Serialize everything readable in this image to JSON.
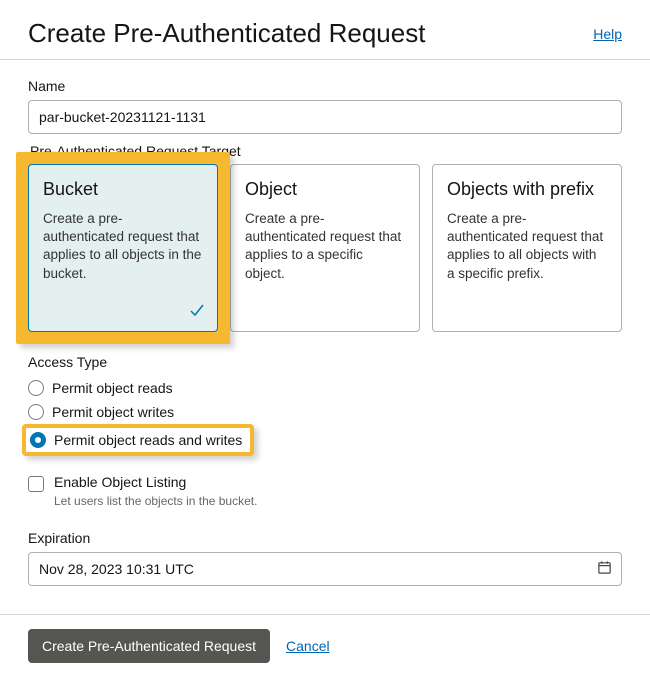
{
  "header": {
    "title": "Create Pre-Authenticated Request",
    "help_label": "Help"
  },
  "form": {
    "name_label": "Name",
    "name_value": "par-bucket-20231121-1131",
    "target_label": "Pre-Authenticated Request Target",
    "targets": [
      {
        "title": "Bucket",
        "desc": "Create a pre-authenticated request that applies to all objects in the bucket.",
        "selected": true
      },
      {
        "title": "Object",
        "desc": "Create a pre-authenticated request that applies to a specific object.",
        "selected": false
      },
      {
        "title": "Objects with prefix",
        "desc": "Create a pre-authenticated request that applies to all objects with a specific prefix.",
        "selected": false
      }
    ],
    "access_type_label": "Access Type",
    "access_options": [
      {
        "label": "Permit object reads",
        "checked": false
      },
      {
        "label": "Permit object writes",
        "checked": false
      },
      {
        "label": "Permit object reads and writes",
        "checked": true
      }
    ],
    "listing_checkbox_label": "Enable Object Listing",
    "listing_help": "Let users list the objects in the bucket.",
    "expiration_label": "Expiration",
    "expiration_value": "Nov 28, 2023 10:31 UTC"
  },
  "footer": {
    "submit_label": "Create Pre-Authenticated Request",
    "cancel_label": "Cancel"
  }
}
